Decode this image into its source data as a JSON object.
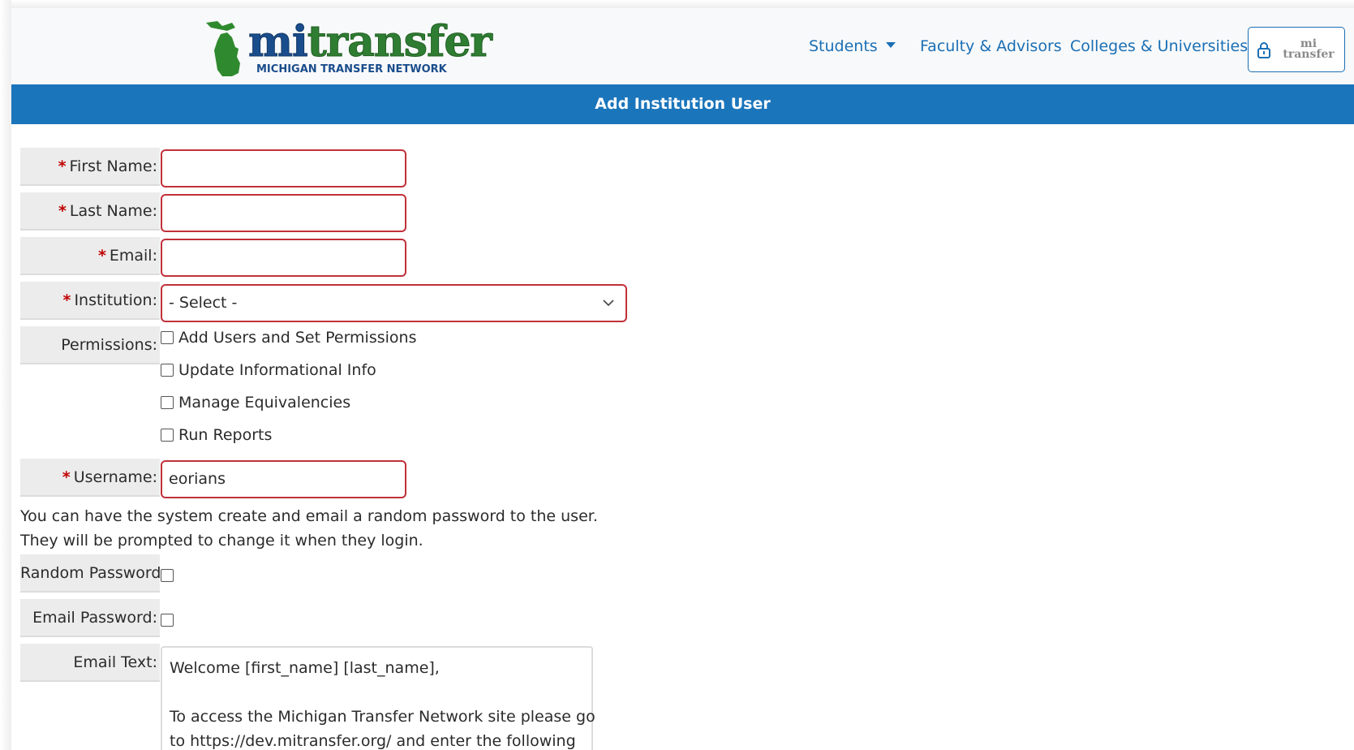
{
  "header": {
    "logo": {
      "brand_mi": "mi",
      "brand_rest": "transfer",
      "tagline": "MICHIGAN TRANSFER NETWORK"
    },
    "nav": {
      "students": "Students",
      "faculty": "Faculty & Advisors",
      "colleges": "Colleges & Universities"
    },
    "login_logo_line1": "mi",
    "login_logo_line2": "transfer"
  },
  "page_title": "Add Institution User",
  "form": {
    "required_mark": "*",
    "first_name_label": "First Name:",
    "first_name_value": "",
    "last_name_label": "Last Name:",
    "last_name_value": "",
    "email_label": "Email:",
    "email_value": "",
    "institution_label": "Institution:",
    "institution_value": "- Select -",
    "permissions_label": "Permissions:",
    "permissions": [
      {
        "label": "Add Users and Set Permissions",
        "checked": false
      },
      {
        "label": "Update Informational Info",
        "checked": false
      },
      {
        "label": "Manage Equivalencies",
        "checked": false
      },
      {
        "label": "Run Reports",
        "checked": false
      }
    ],
    "username_label": "Username:",
    "username_value": "eorians",
    "password_note_line1": "You can have the system create and email a random password to the user.",
    "password_note_line2": "They will be prompted to change it when they login.",
    "random_password_label": "Random Password:",
    "random_password_checked": false,
    "email_password_label": "Email Password:",
    "email_password_checked": false,
    "email_text_label": "Email Text:",
    "email_text_lines": [
      "Welcome [first_name] [last_name],",
      "",
      "To access the Michigan Transfer Network site please go",
      "to https://dev.mitransfer.org/ and enter the following"
    ]
  },
  "colors": {
    "title_bar": "#1b75bb",
    "link": "#1a6fb5",
    "required": "#c00000",
    "invalid_border": "#c0313a",
    "logo_green": "#2f7d32",
    "logo_blue": "#1a4d8c"
  }
}
